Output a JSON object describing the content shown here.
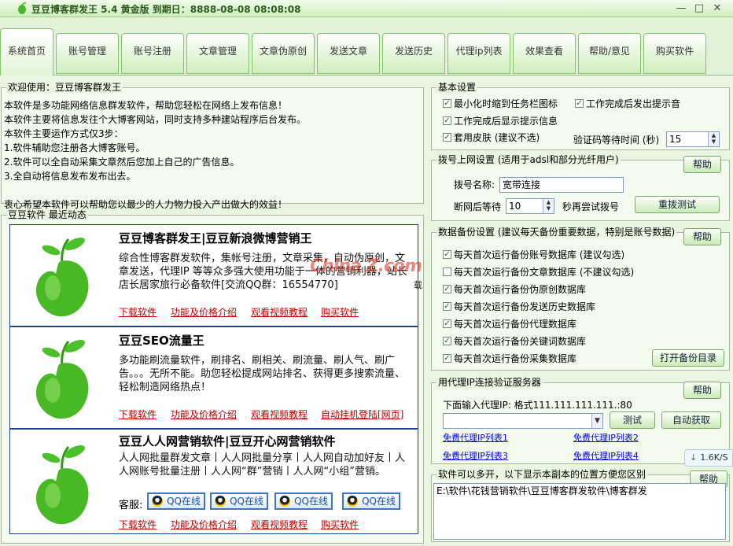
{
  "window": {
    "title": "豆豆博客群发王 5.4 黄金版 到期日：8888-08-08 08:08:08"
  },
  "tabs": [
    "系统首页",
    "账号管理",
    "账号注册",
    "文章管理",
    "文章伪原创",
    "发送文章",
    "发送历史",
    "代理ip列表",
    "效果查看",
    "帮助/意见",
    "购买软件"
  ],
  "welcome": {
    "title": "欢迎使用：豆豆博客群发王",
    "lines": [
      "本软件是多功能网络信息群发软件，帮助您轻松在网络上发布信息！",
      "本软件主要将信息发往个大博客网站，同时支持多种建站程序后台发布。",
      "本软件主要运作方式仅3步：",
      "1.软件辅助您注册各大博客账号。",
      "2.软件可以全自动采集文章然后您加上自己的广告信息。",
      "3.全自动将信息发布发布出去。",
      "",
      "衷心希望本软件可以帮助您以最少的人力物力投入产出做大的效益！"
    ]
  },
  "news": {
    "title": "豆豆软件 最近动态",
    "cards": [
      {
        "title": "豆豆博客群发王|豆豆新浪微博营销王",
        "desc": "综合性博客群发软件，集帐号注册，文章采集，自动伪原创，文章发送，代理IP 等等众多强大使用功能于一体的营销利器，站长店长居家旅行必备软件[交流QQ群：16554770]",
        "links": [
          "下载软件",
          "功能及价格介绍",
          "观看视频教程",
          "购买软件"
        ]
      },
      {
        "title": "豆豆SEO流量王",
        "desc": "多功能刷流量软件，刷排名、刷相关、刷流量、刷人气、刷广告。。。无所不能。助您轻松提成网站排名、获得更多搜索流量、轻松制造网络热点！",
        "links": [
          "下载软件",
          "功能及价格介绍",
          "观看视频教程",
          "自动挂机登陆[网页]"
        ]
      },
      {
        "title": "豆豆人人网营销软件|豆豆开心网营销软件",
        "desc": "人人网批量群发文章丨人人网批量分享丨人人网自动加好友丨人人网账号批量注册丨人人网“群”营销丨人人网“小组”营销。",
        "service_label": "客服:",
        "qq_label": "QQ在线",
        "links": [
          "下载软件",
          "功能及价格介绍",
          "观看视频教程",
          "购买软件"
        ]
      }
    ],
    "watermark": "China Z.com",
    "watermark_dl": "载"
  },
  "basic": {
    "title": "基本设置",
    "opt1": "最小化时缩到任务栏图标",
    "opt2": "工作完成后发出提示音",
    "opt3": "工作完成后显示提示信息",
    "opt4": "套用皮肤 (建议不选)",
    "captcha_label": "验证码等待时间 (秒)",
    "captcha_value": "15"
  },
  "dial": {
    "title": "拨号上网设置 (适用于adsl和部分光纤用户)",
    "help": "帮助",
    "name_label": "拨号名称:",
    "name_value": "宽带连接",
    "wait_label": "断网后等待",
    "wait_value": "10",
    "wait_suffix": "秒再尝试拨号",
    "test_btn": "重拨测试"
  },
  "backup": {
    "title": "数据备份设置 (建议每天备份重要数据，特别是账号数据)",
    "help": "帮助",
    "items": [
      "每天首次运行备份账号数据库 (建议勾选)",
      "每天首次运行备份文章数据库 (不建议勾选)",
      "每天首次运行备份伪原创数据库",
      "每天首次运行备份发送历史数据库",
      "每天首次运行备份代理数据库",
      "每天首次运行备份关键词数据库",
      "每天首次运行备份采集数据库"
    ],
    "open_btn": "打开备份目录"
  },
  "proxy": {
    "title": "用代理IP连接验证服务器",
    "help": "帮助",
    "hint": "下面输入代理IP: 格式111.111.111.111.:80",
    "test_btn": "测试",
    "auto_btn": "自动获取",
    "links": [
      "免费代理IP列表1",
      "免费代理IP列表2",
      "免费代理IP列表3",
      "免费代理IP列表4"
    ],
    "speed": "1.6K/S"
  },
  "multi": {
    "title": "软件可以多开，以下显示本副本的位置方便您区别",
    "help": "帮助",
    "path": "E:\\软件\\花钱营销软件\\豆豆博客群发软件\\博客群发"
  }
}
